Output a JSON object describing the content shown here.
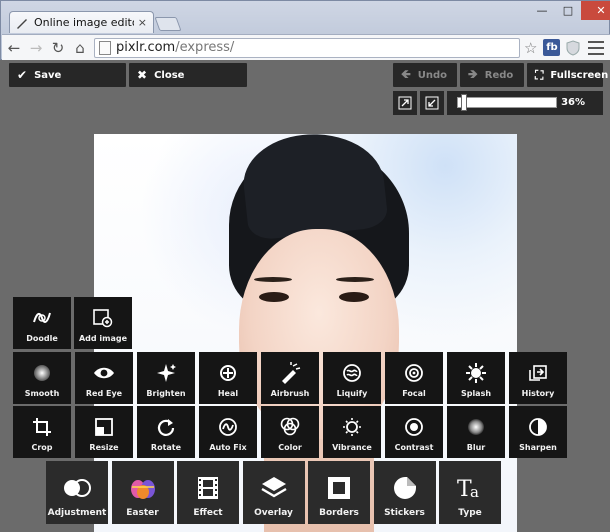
{
  "browser": {
    "tab_title": "Online image editor pixl",
    "tab_close": "×",
    "url_host": "pixlr.com",
    "url_path": "/express/",
    "fb_label": "fb",
    "window_controls": {
      "minimize": "—",
      "maximize": "□",
      "close": "✕"
    }
  },
  "app": {
    "save_label": "Save",
    "close_label": "Close",
    "undo_label": "Undo",
    "redo_label": "Redo",
    "fullscreen_label": "Fullscreen",
    "zoom_label": "36%",
    "zoom_fraction": 0.04
  },
  "tools": {
    "row1": [
      {
        "label": "Doodle",
        "icon": "doodle-icon"
      },
      {
        "label": "Add image",
        "icon": "add-image-icon"
      }
    ],
    "row2": [
      {
        "label": "Smooth",
        "icon": "smooth-icon"
      },
      {
        "label": "Red Eye",
        "icon": "eye-icon"
      },
      {
        "label": "Brighten",
        "icon": "sparkle-icon"
      },
      {
        "label": "Heal",
        "icon": "bandage-icon"
      },
      {
        "label": "Airbrush",
        "icon": "airbrush-icon"
      },
      {
        "label": "Liquify",
        "icon": "liquify-icon"
      },
      {
        "label": "Focal",
        "icon": "target-icon"
      },
      {
        "label": "Splash",
        "icon": "splash-icon"
      },
      {
        "label": "History",
        "icon": "history-icon"
      }
    ],
    "row3": [
      {
        "label": "Crop",
        "icon": "crop-icon"
      },
      {
        "label": "Resize",
        "icon": "resize-icon"
      },
      {
        "label": "Rotate",
        "icon": "rotate-icon"
      },
      {
        "label": "Auto Fix",
        "icon": "auto-fix-icon"
      },
      {
        "label": "Color",
        "icon": "color-icon"
      },
      {
        "label": "Vibrance",
        "icon": "vibrance-icon"
      },
      {
        "label": "Contrast",
        "icon": "contrast-icon"
      },
      {
        "label": "Blur",
        "icon": "blur-icon"
      },
      {
        "label": "Sharpen",
        "icon": "sharpen-icon"
      }
    ],
    "row4": [
      {
        "label": "Adjustment",
        "icon": "adjustment-icon"
      },
      {
        "label": "Easter",
        "icon": "easter-icon"
      },
      {
        "label": "Effect",
        "icon": "film-icon"
      },
      {
        "label": "Overlay",
        "icon": "layers-icon"
      },
      {
        "label": "Borders",
        "icon": "border-icon"
      },
      {
        "label": "Stickers",
        "icon": "sticker-icon"
      },
      {
        "label": "Type",
        "icon": "type-icon"
      }
    ]
  }
}
